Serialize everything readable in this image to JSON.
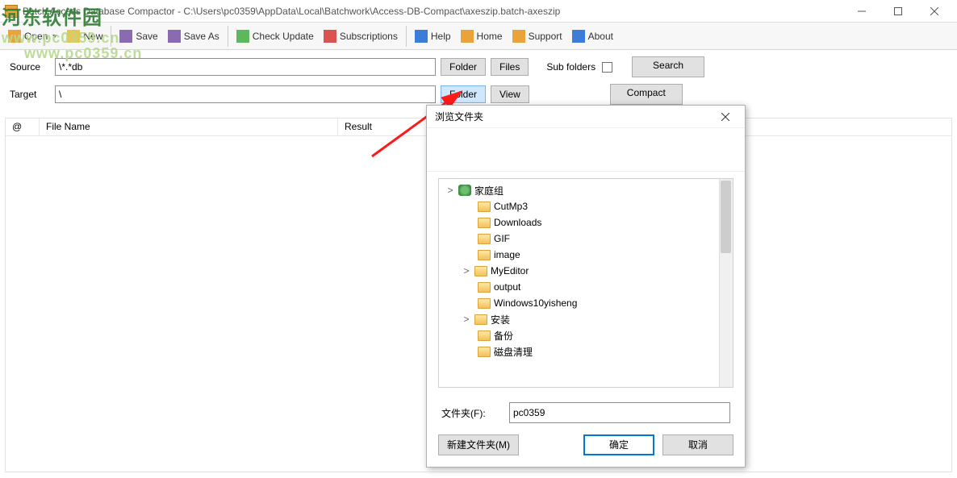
{
  "window": {
    "title": "Batch Access Database Compactor - C:\\Users\\pc0359\\AppData\\Local\\Batchwork\\Access-DB-Compact\\axeszip.batch-axeszip"
  },
  "toolbar": {
    "open": "Open",
    "new": "New",
    "save": "Save",
    "save_as": "Save As",
    "check_update": "Check Update",
    "subscriptions": "Subscriptions",
    "help": "Help",
    "home": "Home",
    "support": "Support",
    "about": "About"
  },
  "form": {
    "source_label": "Source",
    "source_value": "\\*.*db",
    "target_label": "Target",
    "target_value": "\\",
    "folder": "Folder",
    "files": "Files",
    "view": "View",
    "sub_folders": "Sub folders",
    "search": "Search",
    "compact": "Compact"
  },
  "list": {
    "col_at": "@",
    "col_file": "File Name",
    "col_result": "Result"
  },
  "dialog": {
    "title": "浏览文件夹",
    "tree": [
      {
        "indent": 0,
        "chev": ">",
        "name": "家庭组",
        "kind": "group"
      },
      {
        "indent": 1,
        "chev": "",
        "name": "CutMp3",
        "kind": "folder"
      },
      {
        "indent": 1,
        "chev": "",
        "name": "Downloads",
        "kind": "folder"
      },
      {
        "indent": 1,
        "chev": "",
        "name": "GIF",
        "kind": "folder"
      },
      {
        "indent": 1,
        "chev": "",
        "name": "image",
        "kind": "folder"
      },
      {
        "indent": 1,
        "chev": ">",
        "name": "MyEditor",
        "kind": "folder"
      },
      {
        "indent": 1,
        "chev": "",
        "name": "output",
        "kind": "folder"
      },
      {
        "indent": 1,
        "chev": "",
        "name": "Windows10yisheng",
        "kind": "folder"
      },
      {
        "indent": 1,
        "chev": ">",
        "name": "安装",
        "kind": "folder"
      },
      {
        "indent": 1,
        "chev": "",
        "name": "备份",
        "kind": "folder"
      },
      {
        "indent": 1,
        "chev": "",
        "name": "磁盘清理",
        "kind": "folder"
      }
    ],
    "folder_label": "文件夹(F):",
    "folder_value": "pc0359",
    "new_folder": "新建文件夹(M)",
    "ok": "确定",
    "cancel": "取消"
  },
  "watermark": {
    "brand_cn": "河东软件园",
    "brand_url": "www.pc0359.cn"
  }
}
